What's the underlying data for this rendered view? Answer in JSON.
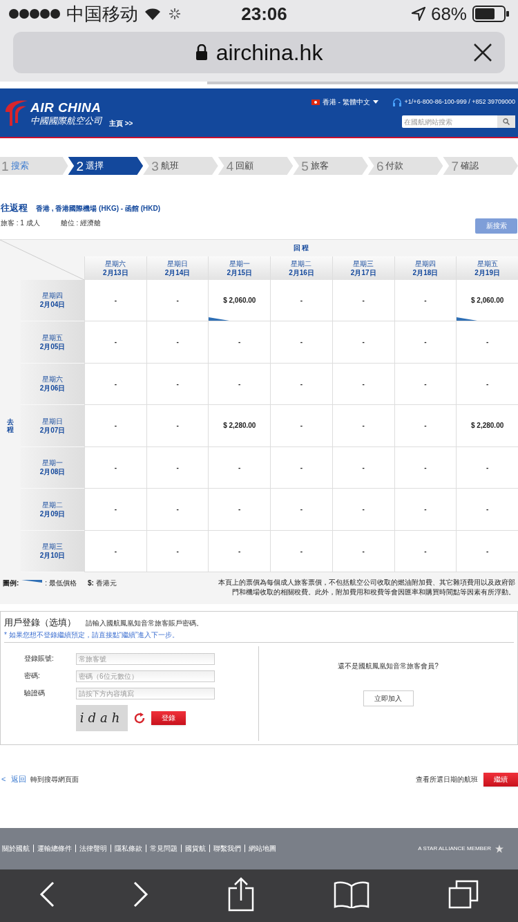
{
  "status_bar": {
    "carrier": "中国移动",
    "time": "23:06",
    "battery": "68%"
  },
  "address_bar": {
    "url": "airchina.hk",
    "load_progress": {
      "level": 0.4
    }
  },
  "header": {
    "brand": "AIR CHINA",
    "brand_chinese": "中國國際航空公司",
    "home_link": "主頁 >>",
    "language": "香港 - 繁體中文",
    "phone": "+1/+6-800-86-100-999 / +852 39709000",
    "search": {
      "placeholder": "在國航網站搜索"
    }
  },
  "steps": [
    {
      "number": "1",
      "label": "搜索",
      "completed": true,
      "selected": false
    },
    {
      "number": "2",
      "label": "選擇",
      "completed": false,
      "selected": true
    },
    {
      "number": "3",
      "label": "航班",
      "completed": false,
      "selected": false
    },
    {
      "number": "4",
      "label": "回顧",
      "completed": false,
      "selected": false
    },
    {
      "number": "5",
      "label": "旅客",
      "completed": false,
      "selected": false
    },
    {
      "number": "6",
      "label": "付款",
      "completed": false,
      "selected": false
    },
    {
      "number": "7",
      "label": "確認",
      "completed": false,
      "selected": false
    }
  ],
  "trip": {
    "type": "往返程",
    "route": "香港 , 香港國際機場 (HKG) - 函館 (HKD)",
    "passengers": "旅客 : 1 成人",
    "cabin": "艙位 : 經濟艙",
    "new_search": "新搜索"
  },
  "fare_table": {
    "return_label": "回 程",
    "outbound_label": "去程",
    "columns": [
      {
        "weekday": "星期六",
        "date": "2月13日"
      },
      {
        "weekday": "星期日",
        "date": "2月14日"
      },
      {
        "weekday": "星期一",
        "date": "2月15日"
      },
      {
        "weekday": "星期二",
        "date": "2月16日"
      },
      {
        "weekday": "星期三",
        "date": "2月17日"
      },
      {
        "weekday": "星期四",
        "date": "2月18日"
      },
      {
        "weekday": "星期五",
        "date": "2月19日"
      }
    ],
    "rows": [
      {
        "weekday": "星期四",
        "date": "2月04日",
        "cells": [
          {
            "price": "-",
            "lowest": false
          },
          {
            "price": "-",
            "lowest": false
          },
          {
            "price": "$ 2,060.00",
            "lowest": true
          },
          {
            "price": "-",
            "lowest": false
          },
          {
            "price": "-",
            "lowest": false
          },
          {
            "price": "-",
            "lowest": false
          },
          {
            "price": "$ 2,060.00",
            "lowest": true
          }
        ]
      },
      {
        "weekday": "星期五",
        "date": "2月05日",
        "cells": [
          {
            "price": "-",
            "lowest": false
          },
          {
            "price": "-",
            "lowest": false
          },
          {
            "price": "-",
            "lowest": false
          },
          {
            "price": "-",
            "lowest": false
          },
          {
            "price": "-",
            "lowest": false
          },
          {
            "price": "-",
            "lowest": false
          },
          {
            "price": "-",
            "lowest": false
          }
        ]
      },
      {
        "weekday": "星期六",
        "date": "2月06日",
        "cells": [
          {
            "price": "-",
            "lowest": false
          },
          {
            "price": "-",
            "lowest": false
          },
          {
            "price": "-",
            "lowest": false
          },
          {
            "price": "-",
            "lowest": false
          },
          {
            "price": "-",
            "lowest": false
          },
          {
            "price": "-",
            "lowest": false
          },
          {
            "price": "-",
            "lowest": false
          }
        ]
      },
      {
        "weekday": "星期日",
        "date": "2月07日",
        "cells": [
          {
            "price": "-",
            "lowest": false
          },
          {
            "price": "-",
            "lowest": false
          },
          {
            "price": "$ 2,280.00",
            "lowest": false
          },
          {
            "price": "-",
            "lowest": false
          },
          {
            "price": "-",
            "lowest": false
          },
          {
            "price": "-",
            "lowest": false
          },
          {
            "price": "$ 2,280.00",
            "lowest": false
          }
        ]
      },
      {
        "weekday": "星期一",
        "date": "2月08日",
        "cells": [
          {
            "price": "-",
            "lowest": false
          },
          {
            "price": "-",
            "lowest": false
          },
          {
            "price": "-",
            "lowest": false
          },
          {
            "price": "-",
            "lowest": false
          },
          {
            "price": "-",
            "lowest": false
          },
          {
            "price": "-",
            "lowest": false
          },
          {
            "price": "-",
            "lowest": false
          }
        ]
      },
      {
        "weekday": "星期二",
        "date": "2月09日",
        "cells": [
          {
            "price": "-",
            "lowest": false
          },
          {
            "price": "-",
            "lowest": false
          },
          {
            "price": "-",
            "lowest": false
          },
          {
            "price": "-",
            "lowest": false
          },
          {
            "price": "-",
            "lowest": false
          },
          {
            "price": "-",
            "lowest": false
          },
          {
            "price": "-",
            "lowest": false
          }
        ]
      },
      {
        "weekday": "星期三",
        "date": "2月10日",
        "cells": [
          {
            "price": "-",
            "lowest": false
          },
          {
            "price": "-",
            "lowest": false
          },
          {
            "price": "-",
            "lowest": false
          },
          {
            "price": "-",
            "lowest": false
          },
          {
            "price": "-",
            "lowest": false
          },
          {
            "price": "-",
            "lowest": false
          },
          {
            "price": "-",
            "lowest": false
          }
        ]
      }
    ]
  },
  "legend": {
    "label": "圖例:",
    "lowest": ": 最低價格",
    "currency": "**$:** 香港元",
    "note": "本頁上的票價為每個成人旅客票價，不包括航空公司收取的燃油附加費、其它雜項費用以及政府部門和機場收取的相關稅費。此外，附加費用和稅費等會因匯率和購買時間點等因素有所浮動。"
  },
  "login": {
    "title": "用戶登錄（选填）",
    "hint": "請輸入國航鳳凰知音常旅客賬戶密碼。",
    "notice": "* 如果您想不登錄繼續預定，請直接點“繼續”進入下一步。",
    "fields": [
      {
        "label": "登錄賬號:",
        "placeholder": "常旅客號"
      },
      {
        "label": "密碼:",
        "placeholder": "密碼（6位元數位）"
      },
      {
        "label": "驗證碼",
        "placeholder": "請按下方內容填寫"
      }
    ],
    "captcha": "idah",
    "submit": "登錄",
    "join_prompt": "還不是國航鳳凰知音常旅客會員?",
    "join": "立即加入"
  },
  "navigation": {
    "back_arrow": "<",
    "back": "返回",
    "back_hint": "轉到搜尋網頁面",
    "continue_hint": "查看所選日期的航班",
    "continue": "繼續"
  },
  "footer": {
    "links": [
      "關於國航",
      "運輸總條件",
      "法律聲明",
      "隱私條款",
      "常見問題",
      "國貨航",
      "聯繫我們",
      "網站地圖"
    ],
    "alliance": "A STAR ALLIANCE MEMBER"
  }
}
